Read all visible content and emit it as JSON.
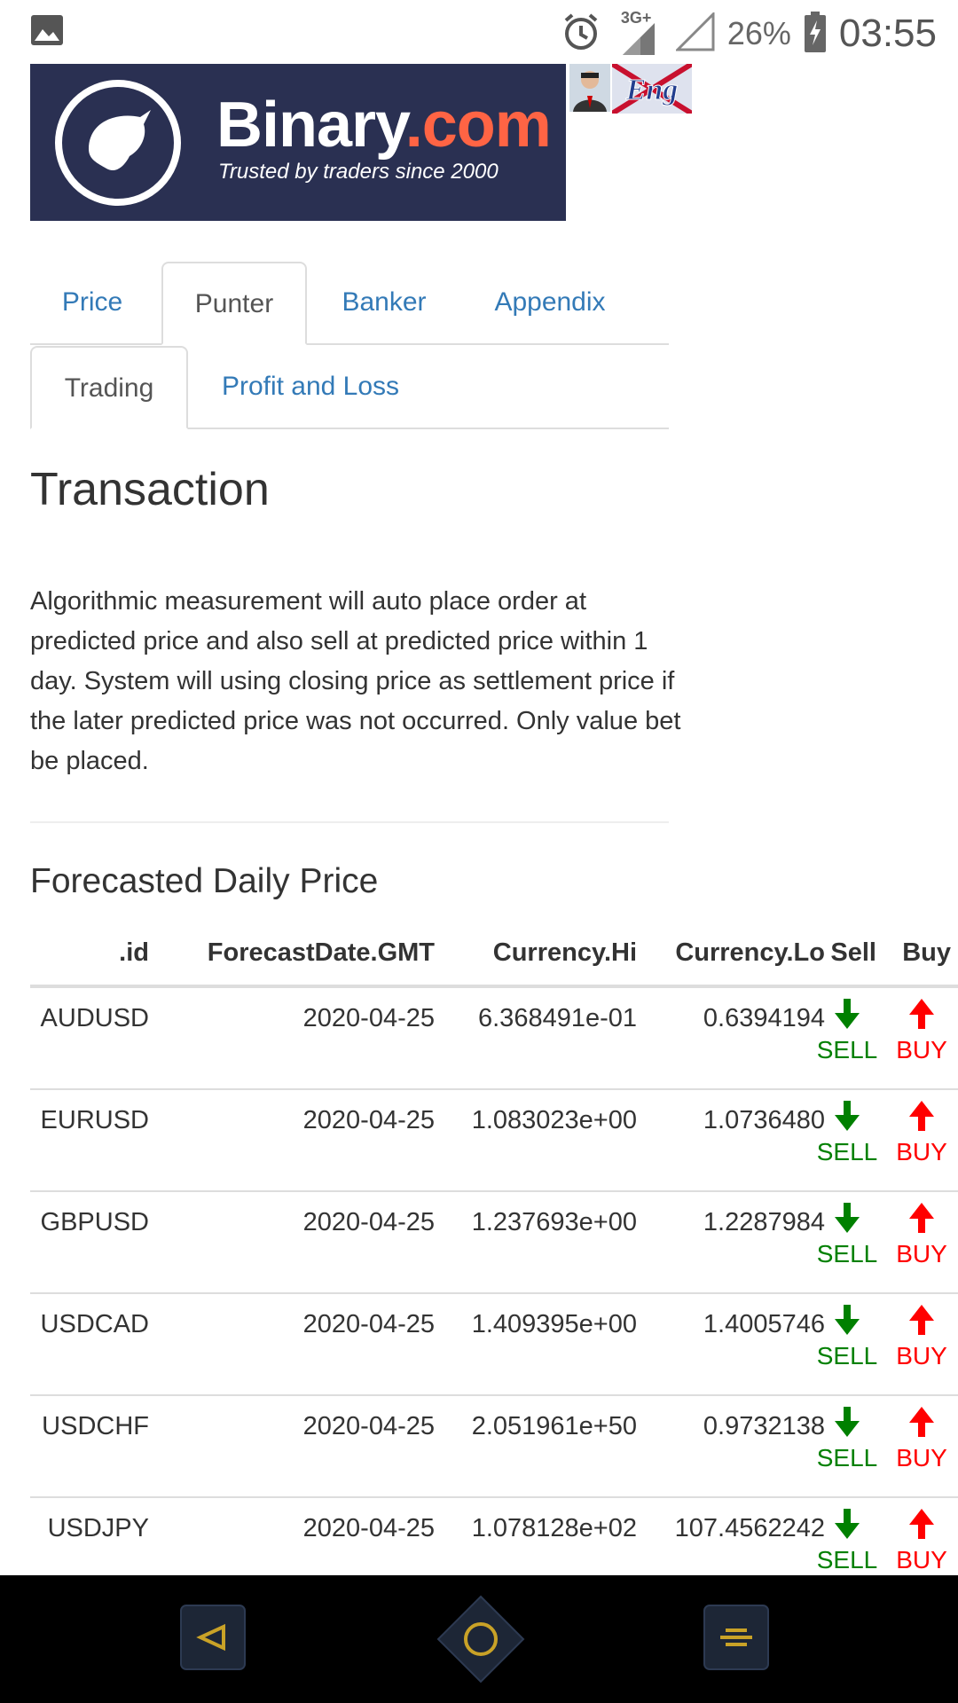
{
  "status_bar": {
    "network": "3G+",
    "battery": "26%",
    "time": "03:55",
    "icons": [
      "image-icon",
      "alarm-icon",
      "signal-icon",
      "signal-empty-icon",
      "battery-charging-icon"
    ]
  },
  "header": {
    "logo_name": "Binary",
    "logo_suffix": ".com",
    "logo_tagline": "Trusted by traders since 2000",
    "language_badge": "Eng"
  },
  "tabs_main": [
    {
      "label": "Price",
      "active": false
    },
    {
      "label": "Punter",
      "active": true
    },
    {
      "label": "Banker",
      "active": false
    },
    {
      "label": "Appendix",
      "active": false
    }
  ],
  "tabs_sub": [
    {
      "label": "Trading",
      "active": true
    },
    {
      "label": "Profit and Loss",
      "active": false
    }
  ],
  "content": {
    "title": "Transaction",
    "description": "Algorithmic measurement will auto place order at predicted price and also sell at predicted price within 1 day. System will using closing price as settlement price if the later predicted price was not occurred. Only value bet be placed.",
    "subtitle": "Forecasted Daily Price"
  },
  "table": {
    "headers": [
      ".id",
      "ForecastDate.GMT",
      "Currency.Hi",
      "Currency.Lo",
      "Sell",
      "Buy"
    ],
    "sell_label": "SELL",
    "buy_label": "BUY",
    "rows": [
      {
        "id": "AUDUSD",
        "date": "2020-04-25",
        "hi": "6.368491e-01",
        "lo": "0.6394194"
      },
      {
        "id": "EURUSD",
        "date": "2020-04-25",
        "hi": "1.083023e+00",
        "lo": "1.0736480"
      },
      {
        "id": "GBPUSD",
        "date": "2020-04-25",
        "hi": "1.237693e+00",
        "lo": "1.2287984"
      },
      {
        "id": "USDCAD",
        "date": "2020-04-25",
        "hi": "1.409395e+00",
        "lo": "1.4005746"
      },
      {
        "id": "USDCHF",
        "date": "2020-04-25",
        "hi": "2.051961e+50",
        "lo": "0.9732138"
      },
      {
        "id": "USDJPY",
        "date": "2020-04-25",
        "hi": "1.078128e+02",
        "lo": "107.4562242"
      }
    ]
  },
  "colors": {
    "link": "#337ab7",
    "sell": "#008000",
    "buy": "#ff0000",
    "logo_bg": "#2a3052",
    "logo_accent": "#ff6444",
    "nav_icon": "#c9a227"
  },
  "navbar": [
    "back-icon",
    "home-icon",
    "recents-icon"
  ]
}
